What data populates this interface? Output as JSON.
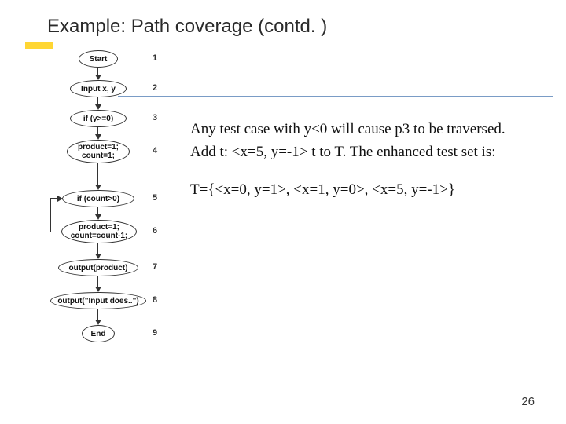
{
  "title": "Example: Path coverage (contd. )",
  "paragraphs": {
    "p1": "Any  test case with y<0 will cause p3 to be traversed.  Add  t: <x=5, y=-1>  t to T.  The enhanced test set is:",
    "p2": "T={<x=0, y=1>, <x=1, y=0>, <x=5, y=-1>}"
  },
  "flow": {
    "n1": "Start",
    "n2": "Input x, y",
    "n3": "if (y>=0)",
    "n4": "product=1;\ncount=1;",
    "n5": "if (count>0)",
    "n6": "product=1;\ncount=count-1;",
    "n7": "output(product)",
    "n8": "output(\"Input does..\")",
    "n9": "End"
  },
  "nums": {
    "k1": "1",
    "k2": "2",
    "k3": "3",
    "k4": "4",
    "k5": "5",
    "k6": "6",
    "k7": "7",
    "k8": "8",
    "k9": "9"
  },
  "pagenum": "26",
  "chart_data": {
    "type": "flowchart",
    "title": "Control-flow graph for path coverage example",
    "nodes": [
      {
        "id": 1,
        "label": "Start",
        "shape": "ellipse"
      },
      {
        "id": 2,
        "label": "Input x, y",
        "shape": "ellipse"
      },
      {
        "id": 3,
        "label": "if (y>=0)",
        "shape": "decision"
      },
      {
        "id": 4,
        "label": "product=1; count=1;",
        "shape": "process"
      },
      {
        "id": 5,
        "label": "if (count>0)",
        "shape": "decision"
      },
      {
        "id": 6,
        "label": "product=1; count=count-1;",
        "shape": "process"
      },
      {
        "id": 7,
        "label": "output(product)",
        "shape": "ellipse"
      },
      {
        "id": 8,
        "label": "output(\"Input does..\")",
        "shape": "ellipse"
      },
      {
        "id": 9,
        "label": "End",
        "shape": "ellipse"
      }
    ],
    "edges": [
      {
        "from": 1,
        "to": 2
      },
      {
        "from": 2,
        "to": 3
      },
      {
        "from": 3,
        "to": 4
      },
      {
        "from": 4,
        "to": 5
      },
      {
        "from": 5,
        "to": 6
      },
      {
        "from": 6,
        "to": 5,
        "note": "loop back"
      },
      {
        "from": 5,
        "to": 7
      },
      {
        "from": 7,
        "to": 8
      },
      {
        "from": 8,
        "to": 9
      }
    ]
  }
}
